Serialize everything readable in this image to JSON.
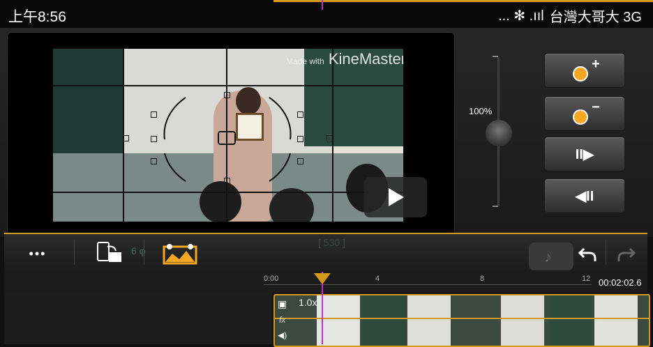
{
  "status_bar": {
    "time": "上午8:56",
    "indicators": "... ✻ .ııl",
    "carrier": "台灣大哥大 3G"
  },
  "preview": {
    "watermark_prefix": "Made with",
    "watermark_brand": "KineMaster"
  },
  "zoom": {
    "label": "100%"
  },
  "controls": {
    "zoom_in_label": "+",
    "zoom_out_label": "−",
    "next_frame_label": "II▶",
    "prev_frame_label": "◀II"
  },
  "toolbar": {
    "more_label": "•••",
    "faded_text_1": "6 φ",
    "faded_text_2": "[ 530 ]"
  },
  "timeline": {
    "ticks": [
      "0:00",
      "4",
      "8",
      "12"
    ],
    "time_readout": "00:02:02.6",
    "clip_speed": "1.0x"
  },
  "colors": {
    "accent": "#d39a1a",
    "playhead": "#c030c0"
  }
}
